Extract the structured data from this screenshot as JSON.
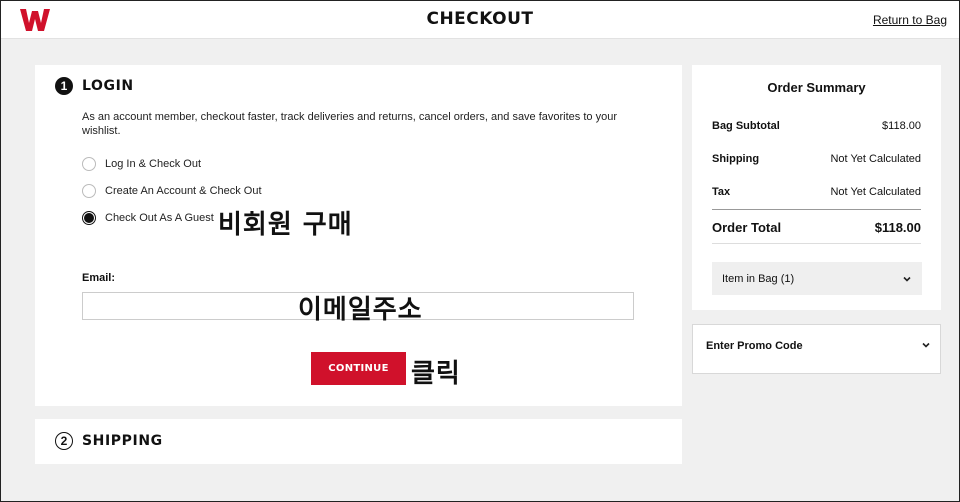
{
  "header": {
    "title": "CHECKOUT",
    "return_link": "Return to Bag",
    "brand_color": "#d0112b"
  },
  "login": {
    "step_number": "1",
    "title": "LOGIN",
    "intro": "As an account member, checkout faster, track deliveries and returns, cancel orders, and save favorites to your wishlist.",
    "options": [
      {
        "label": "Log In & Check Out",
        "selected": false
      },
      {
        "label": "Create An Account & Check Out",
        "selected": false
      },
      {
        "label": "Check Out As A Guest",
        "selected": true
      }
    ],
    "email_label": "Email:",
    "email_value": "",
    "continue_label": "CONTINUE"
  },
  "annotations": {
    "guest": "비회원 구매",
    "email": "이메일주소",
    "click": "클릭"
  },
  "shipping": {
    "step_number": "2",
    "title": "SHIPPING"
  },
  "summary": {
    "title": "Order Summary",
    "rows": [
      {
        "label": "Bag Subtotal",
        "value": "$118.00"
      },
      {
        "label": "Shipping",
        "value": "Not Yet Calculated"
      },
      {
        "label": "Tax",
        "value": "Not Yet Calculated"
      }
    ],
    "total_label": "Order Total",
    "total_value": "$118.00",
    "bag_items": "Item in Bag (1)"
  },
  "promo": {
    "label": "Enter Promo Code"
  }
}
